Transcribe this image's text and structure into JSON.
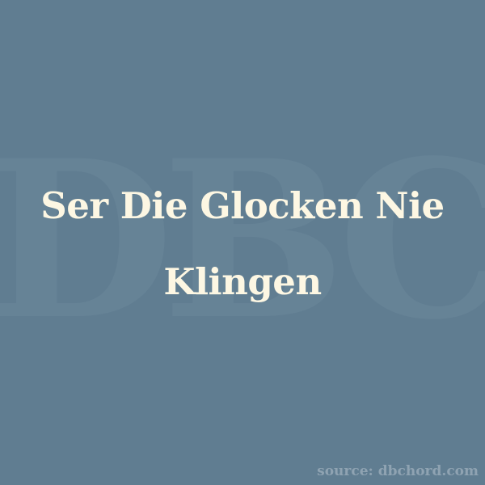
{
  "background_color": "#607d91",
  "watermark": {
    "text": "DBC",
    "color": "#8fa7b8"
  },
  "title": {
    "line1": "Ser Die Glocken Nie",
    "line2": "Klingen",
    "color": "#fdf7e3"
  },
  "source": {
    "text": "source: dbchord.com",
    "color": "#8fa3b2"
  }
}
